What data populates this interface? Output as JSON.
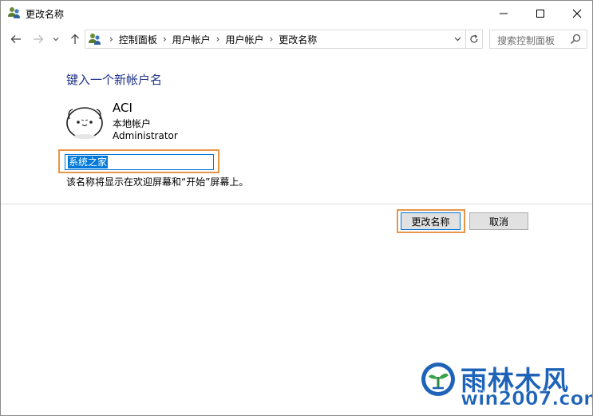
{
  "window": {
    "title": "更改名称"
  },
  "address_bar": {
    "breadcrumbs": [
      "控制面板",
      "用户帐户",
      "用户帐户",
      "更改名称"
    ]
  },
  "search": {
    "placeholder": "搜索控制面板"
  },
  "main": {
    "heading": "键入一个新帐户名",
    "account_name": "ACI",
    "account_type": "本地帐户",
    "account_role": "Administrator",
    "new_name_value": "系统之家",
    "hint": "该名称将显示在欢迎屏幕和“开始”屏幕上。"
  },
  "buttons": {
    "rename": "更改名称",
    "cancel": "取消"
  },
  "watermark": {
    "brand": "雨林木风",
    "site": "win2007.com"
  },
  "colors": {
    "heading": "#1e3287",
    "highlight": "#e8954a",
    "accent": "#0078d7",
    "watermark": "#1e63b8"
  }
}
